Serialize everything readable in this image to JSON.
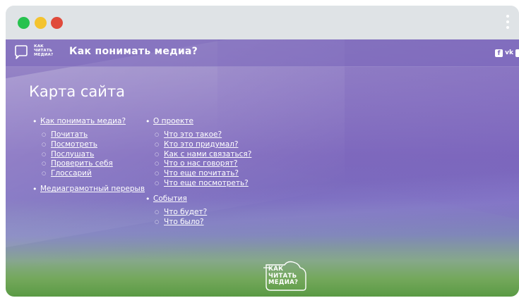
{
  "browser": {
    "controls": [
      "close",
      "minimize",
      "maximize"
    ],
    "menu_icon": "kebab-menu-icon"
  },
  "header": {
    "logo_lines": [
      "КАК",
      "ЧИТАТЬ",
      "МЕДИА?"
    ],
    "title": "Как понимать медиа?",
    "social_icons": [
      "facebook-icon",
      "vk-icon"
    ],
    "fb_glyph": "f",
    "vk_glyph": "vk"
  },
  "page": {
    "heading": "Карта сайта"
  },
  "sitemap": {
    "column1": [
      {
        "label": "Как понимать медиа?",
        "children": [
          "Почитать",
          "Посмотреть",
          "Послушать",
          "Проверить себя",
          "Глоссарий"
        ]
      },
      {
        "label": "Медиаграмотный перерыв",
        "children": []
      }
    ],
    "column2": [
      {
        "label": "О проекте",
        "children": [
          "Что это такое?",
          "Кто это придумал?",
          "Как с нами связаться?",
          "Что о нас говорят?",
          "Что еще почитать?",
          "Что еще посмотреть?"
        ]
      },
      {
        "label": "События",
        "children": [
          "Что будет?",
          "Что было?"
        ]
      }
    ]
  },
  "footer": {
    "logo_lines": [
      "КАК",
      "ЧИТАТЬ",
      "МЕДИА?"
    ]
  },
  "colors": {
    "accent": "#7f6bbf",
    "traffic_green": "#27c24f",
    "traffic_yellow": "#f4c32e",
    "traffic_red": "#e04a3b"
  }
}
